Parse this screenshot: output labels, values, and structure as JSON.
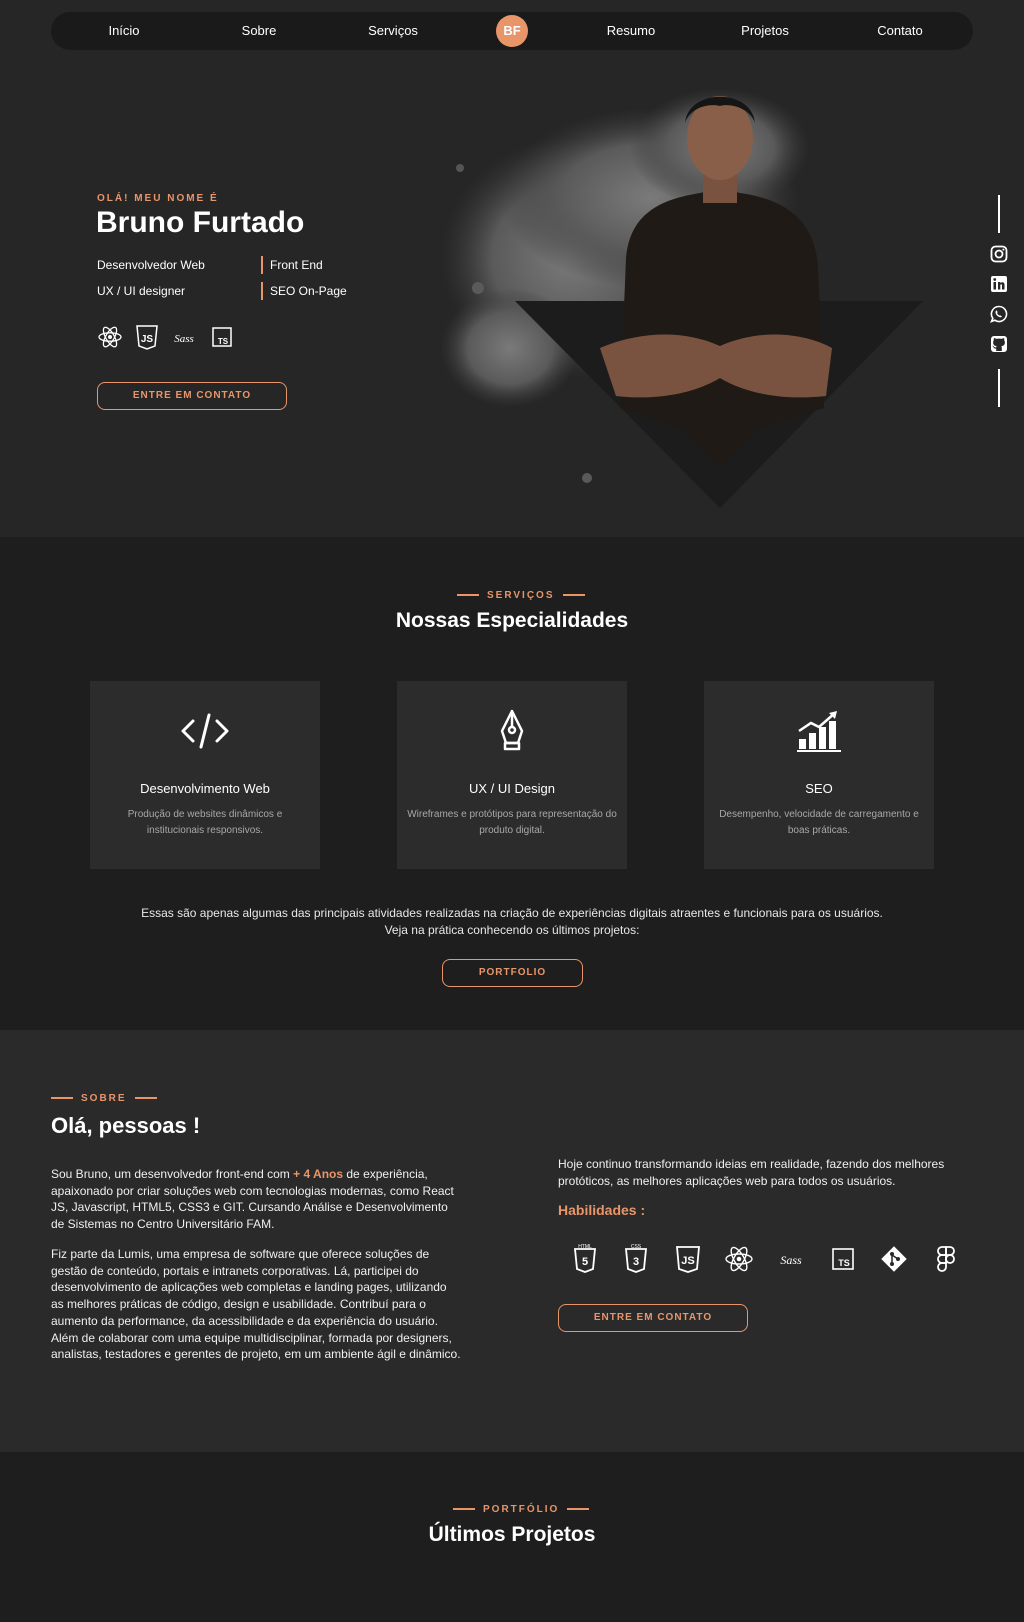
{
  "nav": {
    "items": [
      "Início",
      "Sobre",
      "Serviços",
      "Resumo",
      "Projetos",
      "Contato"
    ],
    "logo": "BF"
  },
  "hero": {
    "greeting": "OLÁ! MEU NOME É",
    "name": "Bruno Furtado",
    "roles": [
      "Desenvolvedor Web",
      "Front End",
      "UX / UI designer",
      "SEO On-Page"
    ],
    "tech_icons": [
      "react-icon",
      "javascript-icon",
      "sass-icon",
      "typescript-icon"
    ],
    "cta": "ENTRE EM CONTATO",
    "social_icons": [
      "instagram-icon",
      "linkedin-icon",
      "whatsapp-icon",
      "github-icon"
    ]
  },
  "services": {
    "eyebrow": "SERVIÇOS",
    "title": "Nossas Especialidades",
    "cards": [
      {
        "icon": "code-icon",
        "title": "Desenvolvimento Web",
        "desc": "Produção de websites dinâmicos e institucionais responsivos."
      },
      {
        "icon": "pen-tool-icon",
        "title": "UX / UI Design",
        "desc": "Wireframes e protótipos para representação do produto digital."
      },
      {
        "icon": "chart-growth-icon",
        "title": "SEO",
        "desc": "Desempenho, velocidade de carregamento e boas práticas."
      }
    ],
    "text": "Essas são apenas algumas das principais atividades realizadas na criação de experiências digitais atraentes e funcionais para os usuários. Veja na prática conhecendo os últimos projetos:",
    "button": "PORTFOLIO"
  },
  "about": {
    "eyebrow": "SOBRE",
    "title": "Olá, pessoas !",
    "p1_before": "Sou Bruno, um desenvolvedor front-end com ",
    "p1_highlight": "+ 4 Anos",
    "p1_after": " de experiência, apaixonado por criar soluções web com tecnologias modernas, como React JS, Javascript, HTML5, CSS3 e GIT. Cursando Análise e Desenvolvimento de Sistemas no Centro Universitário FAM.",
    "p2": "Fiz parte da Lumis, uma empresa de software que oferece soluções de gestão de conteúdo, portais e intranets corporativas. Lá, participei do desenvolvimento de aplicações web completas e landing pages, utilizando as melhores práticas de código, design e usabilidade. Contribuí para o aumento da performance, da acessibilidade e da experiência do usuário. Além de colaborar com uma equipe multidisciplinar, formada por designers, analistas, testadores e gerentes de projeto, em um ambiente ágil e dinâmico.",
    "p3": "Hoje continuo transformando ideias em realidade, fazendo dos melhores protóticos, as melhores aplicações web para todos os usuários.",
    "skills_title": "Habilidades :",
    "skills": [
      "html5-icon",
      "css3-icon",
      "javascript-icon",
      "react-icon",
      "sass-icon",
      "typescript-icon",
      "git-icon",
      "figma-icon"
    ],
    "button": "ENTRE EM CONTATO"
  },
  "portfolio": {
    "eyebrow": "PORTFÓLIO",
    "title": "Últimos Projetos"
  },
  "colors": {
    "accent": "#e8956a",
    "bg_dark": "#1e1e1e",
    "bg": "#262626",
    "card": "#2c2c2c"
  }
}
